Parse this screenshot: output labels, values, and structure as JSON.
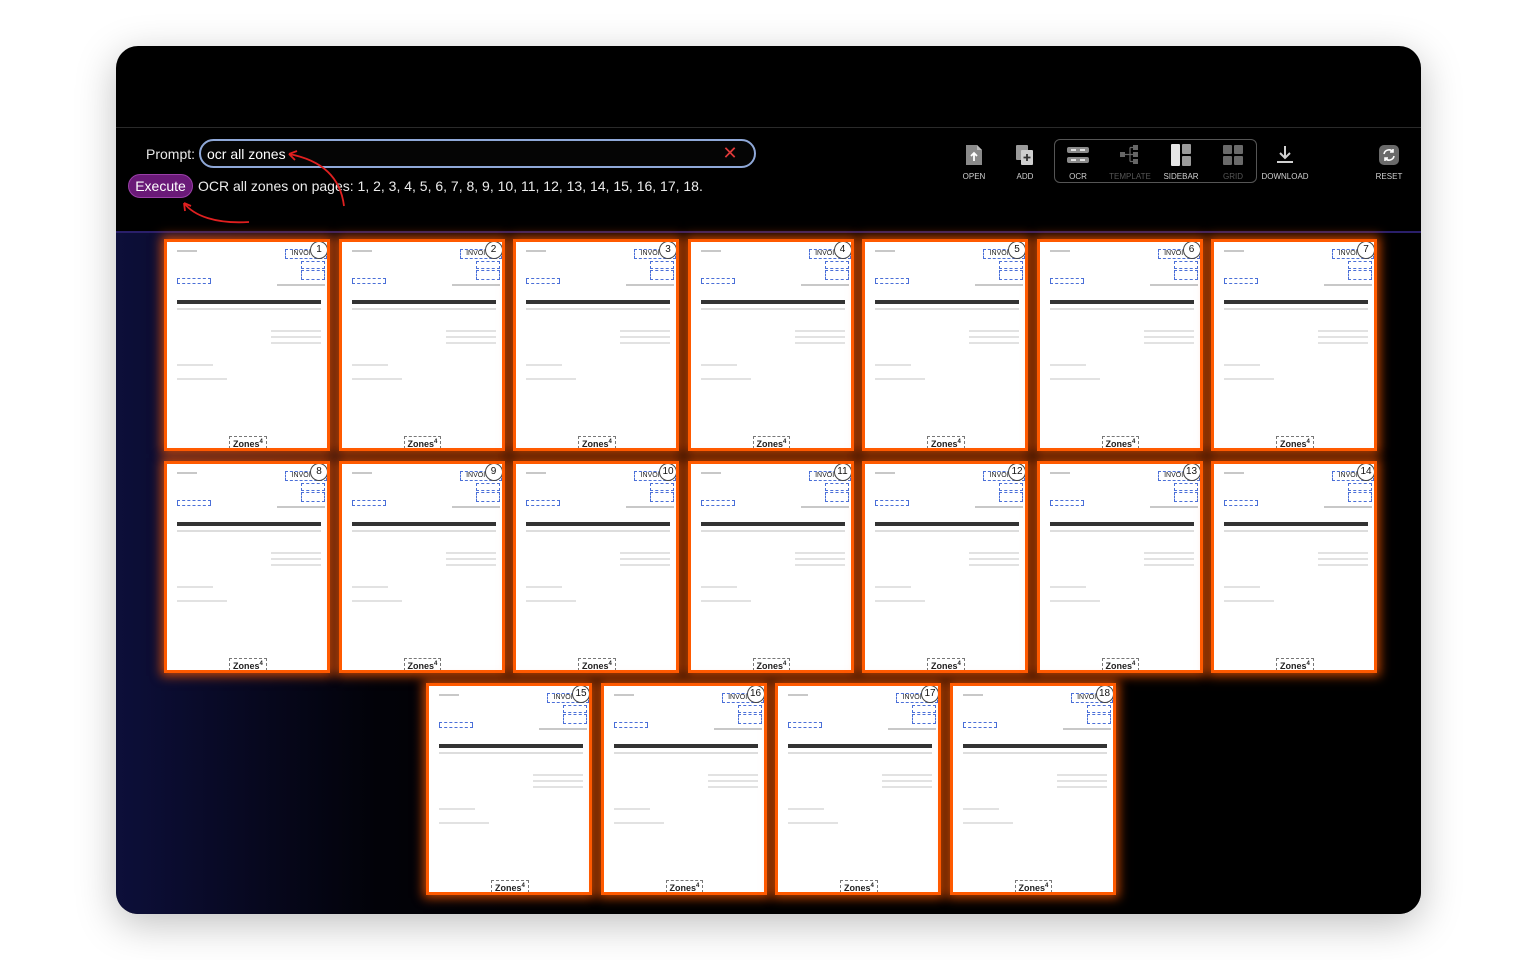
{
  "prompt": {
    "label": "Prompt:",
    "value": "ocr all zones",
    "execute_label": "Execute",
    "status": "OCR all zones on pages: 1, 2, 3, 4, 5, 6, 7, 8, 9, 10, 11, 12, 13, 14, 15, 16, 17, 18."
  },
  "toolbar": {
    "open": "OPEN",
    "add": "ADD",
    "ocr": "OCR",
    "template": "TEMPLATE",
    "sidebar": "SIDEBAR",
    "grid": "GRID",
    "download": "DOWNLOAD",
    "reset": "RESET"
  },
  "colors": {
    "accent": "#ff5a00",
    "execute_bg": "#6a1a78",
    "input_border": "#8fa8d8",
    "clear": "#e03a3a",
    "arrow": "#e02020"
  },
  "page_card": {
    "invoice_label": "INVOICE",
    "zones_label": "Zones",
    "zones_count": "4"
  },
  "pages": [
    {
      "number": "1"
    },
    {
      "number": "2"
    },
    {
      "number": "3"
    },
    {
      "number": "4"
    },
    {
      "number": "5"
    },
    {
      "number": "6"
    },
    {
      "number": "7"
    },
    {
      "number": "8"
    },
    {
      "number": "9"
    },
    {
      "number": "10"
    },
    {
      "number": "11"
    },
    {
      "number": "12"
    },
    {
      "number": "13"
    },
    {
      "number": "14"
    },
    {
      "number": "15"
    },
    {
      "number": "16"
    },
    {
      "number": "17"
    },
    {
      "number": "18"
    }
  ]
}
